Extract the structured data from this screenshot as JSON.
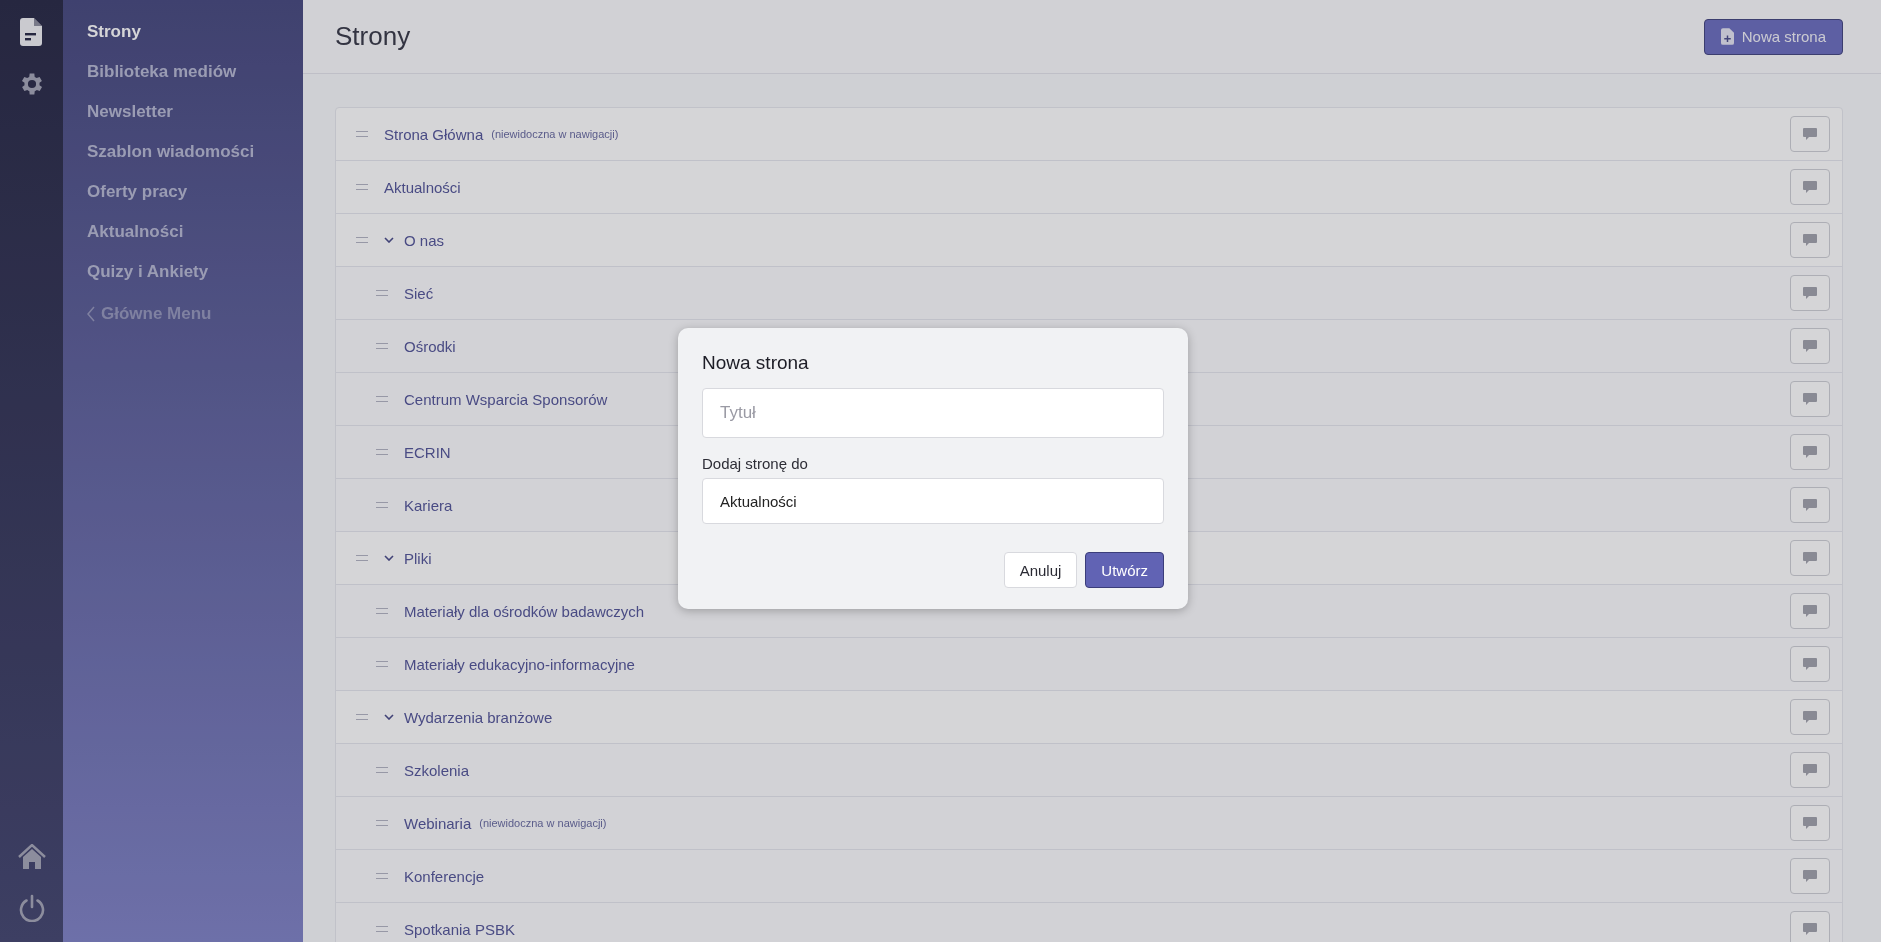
{
  "rail": {
    "top": [
      {
        "kind": "pages",
        "selected": true
      },
      {
        "kind": "settings",
        "selected": false
      }
    ],
    "bottom": [
      {
        "kind": "home"
      },
      {
        "kind": "power"
      }
    ]
  },
  "sidebar": {
    "items": [
      {
        "label": "Strony",
        "selected": true
      },
      {
        "label": "Biblioteka mediów",
        "selected": false
      },
      {
        "label": "Newsletter",
        "selected": false
      },
      {
        "label": "Szablon wiadomości",
        "selected": false
      },
      {
        "label": "Oferty pracy",
        "selected": false
      },
      {
        "label": "Aktualności",
        "selected": false
      },
      {
        "label": "Quizy i Ankiety",
        "selected": false
      }
    ],
    "back_link": "Główne Menu"
  },
  "header": {
    "title": "Strony",
    "new_button": "Nowa strona"
  },
  "pages": [
    {
      "title": "Strona Główna",
      "note": "(niewidoczna w nawigacji)"
    },
    {
      "title": "Aktualności"
    },
    {
      "title": "O nas",
      "expanded": true,
      "children": [
        {
          "title": "Sieć"
        },
        {
          "title": "Ośrodki"
        },
        {
          "title": "Centrum Wsparcia Sponsorów"
        },
        {
          "title": "ECRIN"
        },
        {
          "title": "Kariera"
        }
      ]
    },
    {
      "title": "Pliki",
      "expanded": true,
      "children": [
        {
          "title": "Materiały dla ośrodków badawczych"
        },
        {
          "title": "Materiały edukacyjno-informacyjne"
        }
      ]
    },
    {
      "title": "Wydarzenia branżowe",
      "expanded": true,
      "children": [
        {
          "title": "Szkolenia"
        },
        {
          "title": "Webinaria",
          "note": "(niewidoczna w nawigacji)"
        },
        {
          "title": "Konferencje"
        },
        {
          "title": "Spotkania PSBK"
        }
      ]
    }
  ],
  "dialog": {
    "title": "Nowa strona",
    "title_field": {
      "placeholder": "Tytuł"
    },
    "parent_label": "Dodaj stronę do",
    "parent_field": {
      "value": "Aktualności"
    },
    "buttons": {
      "cancel": "Anuluj",
      "create": "Utwórz"
    }
  }
}
